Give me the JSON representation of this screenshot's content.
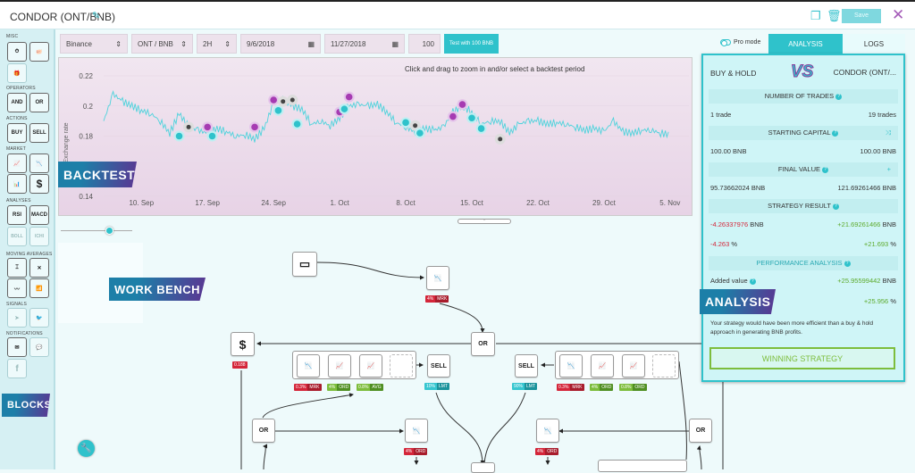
{
  "header": {
    "title": "CONDOR (ONT/BNB)",
    "save_label": "Save",
    "icons": [
      "edit-pencil-icon",
      "duplicate-icon",
      "trash-icon",
      "close-icon"
    ]
  },
  "sidebar": {
    "sections": [
      {
        "label": "MISC",
        "blocks": [
          "timer-icon",
          "piggy-bank-icon",
          "gift-icon"
        ]
      },
      {
        "label": "OPERATORS",
        "blocks": [
          "AND",
          "OR"
        ]
      },
      {
        "label": "ACTIONS",
        "blocks": [
          "BUY",
          "SELL"
        ]
      },
      {
        "label": "MARKET",
        "blocks": [
          "candle-up-icon",
          "candle-down-icon",
          "bar-chart-icon",
          "$"
        ]
      },
      {
        "label": "ANALYSES",
        "blocks": [
          "RSI",
          "MACD",
          "BOLL",
          "ICHI"
        ]
      },
      {
        "label": "MOVING AVERAGES",
        "blocks": [
          "ma-cross-icon",
          "ma-curve-icon",
          "ma-line-icon",
          "ma-bars-icon"
        ]
      },
      {
        "label": "SIGNALS",
        "blocks": [
          "telegram-icon",
          "twitter-icon"
        ]
      },
      {
        "label": "NOTIFICATIONS",
        "blocks": [
          "email-icon",
          "chat-icon",
          "facebook-icon"
        ]
      }
    ],
    "tag": "BLOCKS"
  },
  "backtest": {
    "exchange": "Binance",
    "pair": "ONT / BNB",
    "interval": "2H",
    "start_date": "9/6/2018",
    "end_date": "11/27/2018",
    "amount": "100",
    "test_button": "Test with 100 BNB",
    "tag": "BACKTEST"
  },
  "chart_data": {
    "type": "line",
    "title": "",
    "hint": "Click and drag to zoom in and/or select a backtest period",
    "ylabel": "Exchange rate",
    "xlabel": "",
    "ylim": [
      0.14,
      0.22
    ],
    "yticks": [
      "0.22",
      "0.2",
      "0.18",
      "0.14"
    ],
    "xticks": [
      "10. Sep",
      "17. Sep",
      "24. Sep",
      "1. Oct",
      "8. Oct",
      "15. Oct",
      "22. Oct",
      "29. Oct",
      "5. Nov"
    ],
    "series": [
      {
        "name": "ONT/BNB",
        "color": "#4fd3dc",
        "x_days": [
          0,
          1,
          2,
          3,
          4,
          5,
          6,
          7,
          8,
          9,
          10,
          11,
          12,
          13,
          14,
          15,
          16,
          17,
          18,
          19,
          20,
          21,
          22,
          23,
          24,
          25,
          26,
          27,
          28,
          29,
          30,
          31,
          32,
          33,
          34,
          35,
          36,
          37,
          38,
          39,
          40,
          41,
          42,
          43,
          44,
          45,
          46,
          47,
          48,
          49,
          50,
          51,
          52,
          53,
          54,
          55,
          56,
          57,
          58,
          59,
          60
        ],
        "values": [
          0.19,
          0.208,
          0.203,
          0.2,
          0.197,
          0.195,
          0.19,
          0.182,
          0.195,
          0.186,
          0.184,
          0.182,
          0.185,
          0.183,
          0.18,
          0.181,
          0.178,
          0.185,
          0.202,
          0.204,
          0.2,
          0.198,
          0.188,
          0.19,
          0.187,
          0.192,
          0.2,
          0.201,
          0.2,
          0.201,
          0.196,
          0.189,
          0.186,
          0.183,
          0.185,
          0.184,
          0.186,
          0.196,
          0.2,
          0.196,
          0.188,
          0.19,
          0.19,
          0.182,
          0.188,
          0.19,
          0.19,
          0.188,
          0.189,
          0.188,
          0.186,
          0.184,
          0.185,
          0.183,
          0.19,
          0.183,
          0.182,
          0.184,
          0.184,
          0.182,
          0.181
        ]
      }
    ],
    "markers": [
      {
        "type": "buy",
        "day": 8,
        "value": 0.18
      },
      {
        "type": "neutral",
        "day": 9,
        "value": 0.186
      },
      {
        "type": "sell",
        "day": 11,
        "value": 0.186
      },
      {
        "type": "buy",
        "day": 11.5,
        "value": 0.18
      },
      {
        "type": "sell",
        "day": 16,
        "value": 0.186
      },
      {
        "type": "sell",
        "day": 18,
        "value": 0.204
      },
      {
        "type": "buy",
        "day": 18.5,
        "value": 0.197
      },
      {
        "type": "neutral",
        "day": 19,
        "value": 0.203
      },
      {
        "type": "neutral",
        "day": 20,
        "value": 0.204
      },
      {
        "type": "buy",
        "day": 20.5,
        "value": 0.188
      },
      {
        "type": "sell",
        "day": 25,
        "value": 0.196
      },
      {
        "type": "buy",
        "day": 25.5,
        "value": 0.198
      },
      {
        "type": "sell",
        "day": 26,
        "value": 0.206
      },
      {
        "type": "buy",
        "day": 32,
        "value": 0.189
      },
      {
        "type": "neutral",
        "day": 33,
        "value": 0.187
      },
      {
        "type": "buy",
        "day": 33.5,
        "value": 0.182
      },
      {
        "type": "sell",
        "day": 37,
        "value": 0.193
      },
      {
        "type": "sell",
        "day": 38,
        "value": 0.201
      },
      {
        "type": "buy",
        "day": 39,
        "value": 0.192
      },
      {
        "type": "buy",
        "day": 40,
        "value": 0.185
      },
      {
        "type": "neutral",
        "day": 42,
        "value": 0.178
      }
    ],
    "legend": "none",
    "grid": true
  },
  "workbench": {
    "tag": "WORK BENCH",
    "nodes": {
      "or": "OR",
      "sell": "SELL",
      "dollar": "$",
      "dollar_value": "0.188"
    },
    "badges": [
      {
        "pct": "4%",
        "type": "MRK",
        "color": "red"
      },
      {
        "pct": "0.3%",
        "type": "MRK",
        "color": "red"
      },
      {
        "pct": "4%",
        "type": "ORD",
        "color": "green"
      },
      {
        "pct": "0.8%",
        "type": "AVG",
        "color": "green"
      },
      {
        "pct": "10%",
        "type": "LMT",
        "color": "teal"
      },
      {
        "pct": "90%",
        "type": "LMT",
        "color": "teal"
      },
      {
        "pct": "0.3%",
        "type": "MRK",
        "color": "red"
      },
      {
        "pct": "4%",
        "type": "ORD",
        "color": "green"
      },
      {
        "pct": "0.8%",
        "type": "ORD",
        "color": "green"
      },
      {
        "pct": "4%",
        "type": "ORD",
        "color": "red"
      },
      {
        "pct": "4%",
        "type": "ORD",
        "color": "red"
      }
    ]
  },
  "analysis": {
    "pro_mode": "Pro mode",
    "tabs": [
      "ANALYSIS",
      "LOGS"
    ],
    "left_title": "BUY & HOLD",
    "vs": "VS",
    "right_title": "CONDOR (ONT/...",
    "sections": {
      "trades": {
        "label": "NUMBER OF TRADES",
        "left": "1 trade",
        "right": "19 trades"
      },
      "capital": {
        "label": "STARTING CAPITAL",
        "left": "100.00 BNB",
        "right": "100.00 BNB"
      },
      "final": {
        "label": "FINAL VALUE",
        "left": "95.73662024 BNB",
        "right": "121.69261466 BNB"
      },
      "result": {
        "label": "STRATEGY RESULT",
        "left": "-4.26337976",
        "left_unit": "BNB",
        "right": "+21.69261466",
        "right_unit": "BNB",
        "left_pct": "-4.263",
        "right_pct": "+21.693",
        "pct_unit": "%"
      },
      "performance": {
        "label": "PERFORMANCE ANALYSIS",
        "added_label": "Added value",
        "added_value": "+25.95599442",
        "added_unit": "BNB",
        "added_pct": "+25.956",
        "pct_unit": "%"
      }
    },
    "summary": "Your strategy would have been more efficient than a buy & hold approach in generating BNB profits.",
    "verdict": "WINNING STRATEGY",
    "tag": "ANALYSIS"
  },
  "colors": {
    "accent": "#2fc2cb",
    "buy": "#2fc2cb",
    "sell": "#a63bb2",
    "negative": "#d4263a",
    "positive": "#5daa2c"
  }
}
